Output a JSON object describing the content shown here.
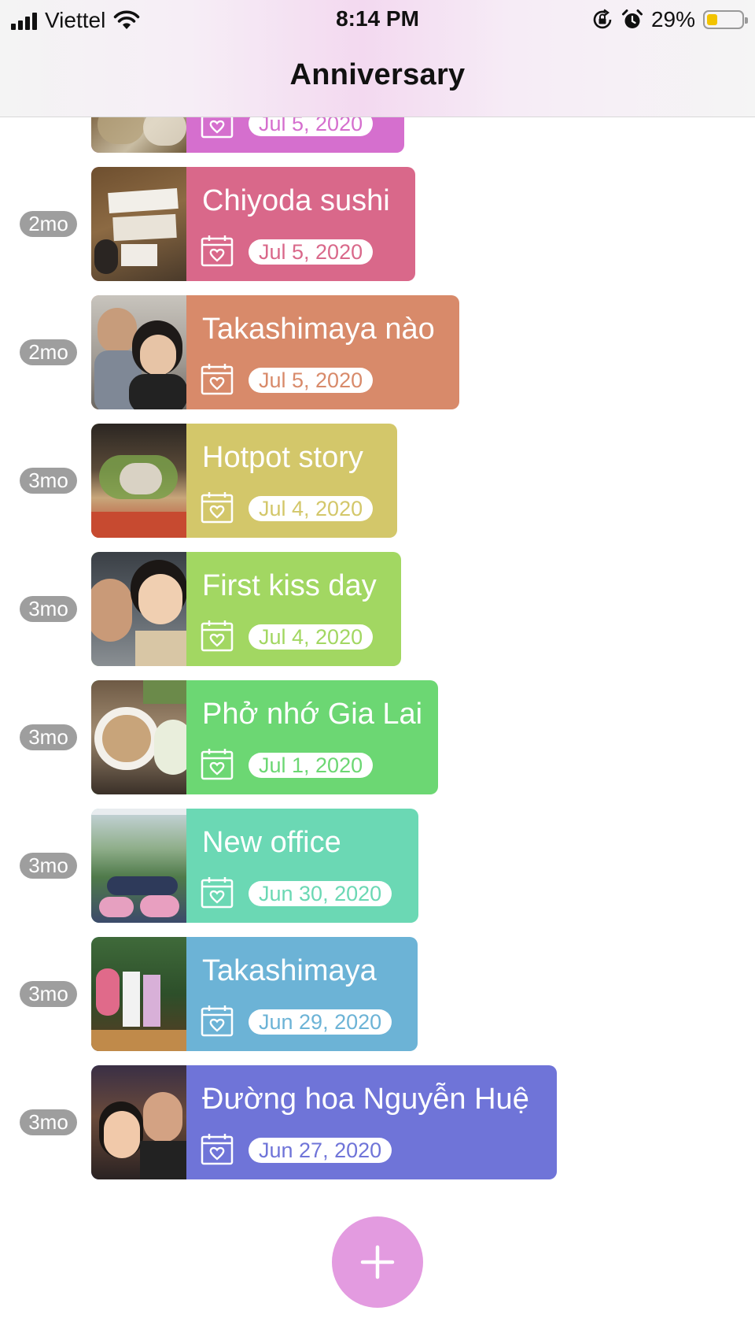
{
  "status": {
    "carrier": "Viettel",
    "time": "8:14 PM",
    "battery": "29%"
  },
  "nav": {
    "title": "Anniversary"
  },
  "items": [
    {
      "age": "",
      "title": "",
      "date": "Jul 5, 2020",
      "color": "#d56fce"
    },
    {
      "age": "2mo",
      "title": "Chiyoda sushi",
      "date": "Jul 5, 2020",
      "color": "#d9688a"
    },
    {
      "age": "2mo",
      "title": "Takashimaya nào",
      "date": "Jul 5, 2020",
      "color": "#d88a6a"
    },
    {
      "age": "3mo",
      "title": "Hotpot story",
      "date": "Jul 4, 2020",
      "color": "#d3c76a"
    },
    {
      "age": "3mo",
      "title": "First kiss day",
      "date": "Jul 4, 2020",
      "color": "#a2d762"
    },
    {
      "age": "3mo",
      "title": "Phở nhớ Gia Lai",
      "date": "Jul 1, 2020",
      "color": "#6cd773"
    },
    {
      "age": "3mo",
      "title": "New office",
      "date": "Jun 30, 2020",
      "color": "#6bd8b4"
    },
    {
      "age": "3mo",
      "title": "Takashimaya",
      "date": "Jun 29, 2020",
      "color": "#6cb3d6"
    },
    {
      "age": "3mo",
      "title": "Đường hoa Nguyễn Huệ",
      "date": "Jun 27, 2020",
      "color": "#6f74d8"
    }
  ],
  "fab": {
    "icon": "plus-icon",
    "color": "#e39be0"
  }
}
